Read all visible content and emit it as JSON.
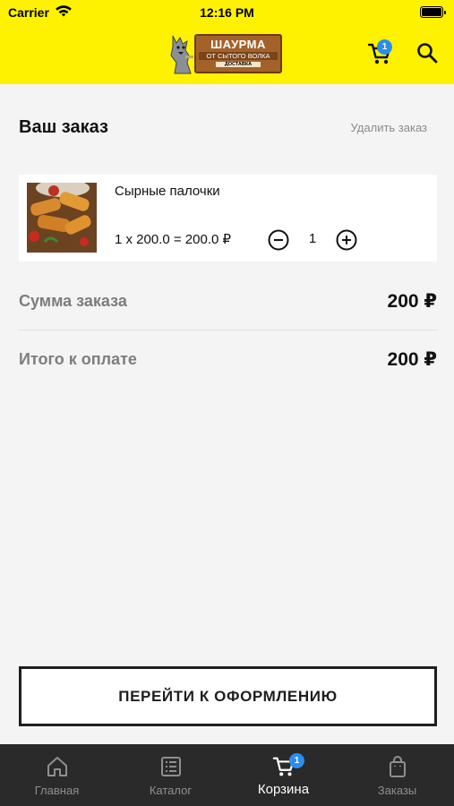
{
  "status_bar": {
    "carrier": "Carrier",
    "time": "12:16 PM"
  },
  "header": {
    "logo": {
      "title": "ШАУРМА",
      "subtitle": "ОТ СЫТОГО ВОЛКА",
      "tag": "ДОСТАВКА"
    },
    "cart_count": "1",
    "cart_icon": "cart-icon",
    "search_icon": "search-icon",
    "background": "#fff200"
  },
  "order": {
    "title": "Ваш заказ",
    "delete_label": "Удалить заказ",
    "items": [
      {
        "name": "Сырные палочки",
        "calc": "1 x 200.0 = 200.0 ₽",
        "quantity": "1"
      }
    ]
  },
  "summary": {
    "subtotal_label": "Сумма заказа",
    "subtotal_value": "200 ₽",
    "total_label": "Итого к оплате",
    "total_value": "200 ₽"
  },
  "checkout_label": "ПЕРЕЙТИ К ОФОРМЛЕНИЮ",
  "tabbar": {
    "active_color": "#ffffff",
    "inactive_color": "#8f8f8f",
    "badge_color": "#2b8df0",
    "tabs": [
      {
        "label": "Главная",
        "icon": "home-icon"
      },
      {
        "label": "Каталог",
        "icon": "catalog-icon"
      },
      {
        "label": "Корзина",
        "icon": "cart-icon",
        "badge": "1"
      },
      {
        "label": "Заказы",
        "icon": "bag-icon"
      }
    ]
  }
}
